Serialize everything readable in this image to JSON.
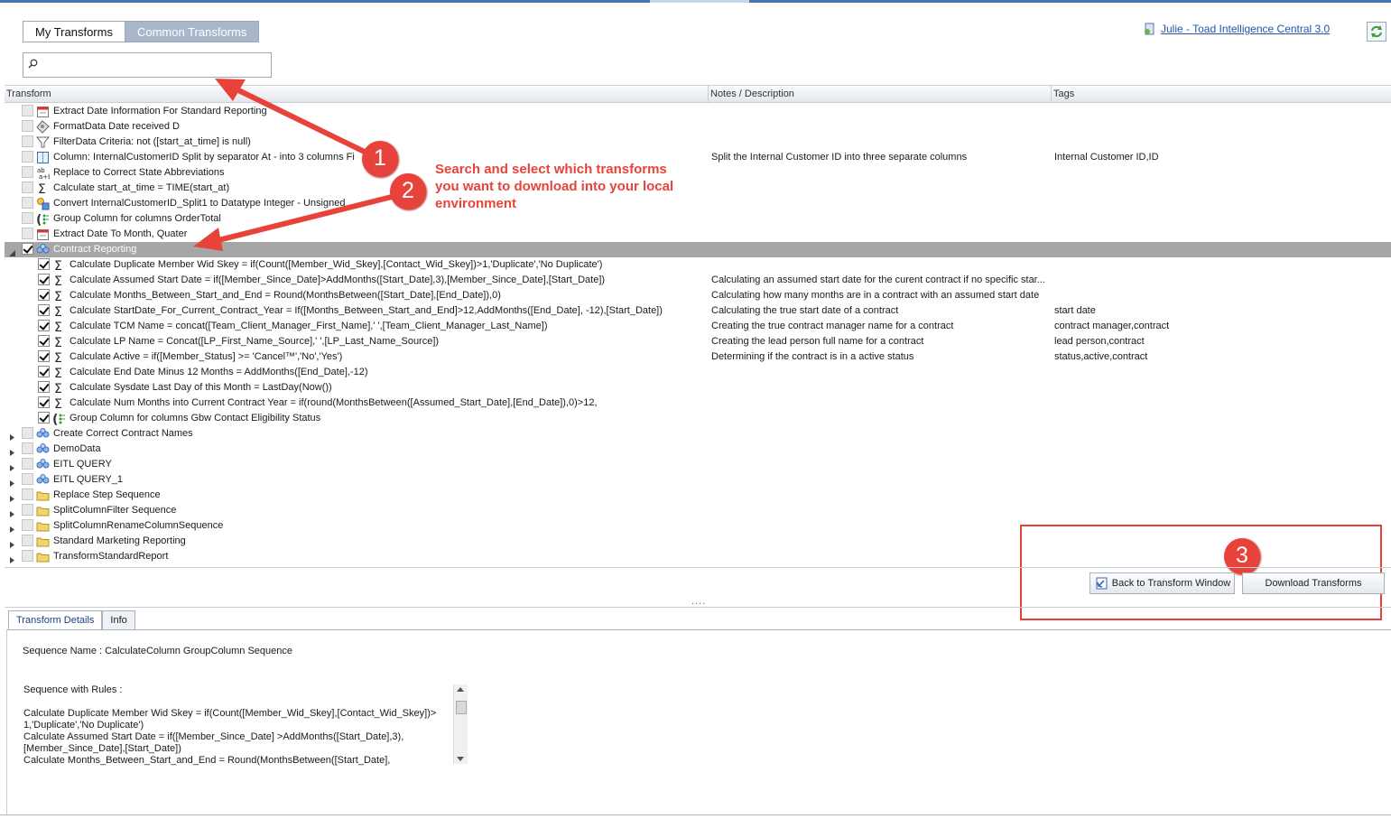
{
  "tabs": [
    {
      "label": "My Transforms",
      "active": true
    },
    {
      "label": "Common Transforms",
      "active": false
    }
  ],
  "search": {
    "value": ""
  },
  "account": {
    "link": "Julie - Toad Intelligence Central 3.0"
  },
  "columns": {
    "transform": "Transform",
    "notes": "Notes / Description",
    "tags": "Tags"
  },
  "rows": [
    {
      "type": "item",
      "level": 0,
      "checked": false,
      "icon": "calendar-icon",
      "label": "Extract Date Information For Standard Reporting",
      "desc": "",
      "tags": ""
    },
    {
      "type": "item",
      "level": 0,
      "checked": false,
      "icon": "format-icon",
      "label": "FormatData Date received D",
      "desc": "",
      "tags": ""
    },
    {
      "type": "item",
      "level": 0,
      "checked": false,
      "icon": "filter-icon",
      "label": "FilterData Criteria: not ([start_at_time] is null)",
      "desc": "",
      "tags": ""
    },
    {
      "type": "item",
      "level": 0,
      "checked": false,
      "icon": "split-column-icon",
      "label": "Column: InternalCustomerID Split by separator At - into 3 columns Fi",
      "desc": "Split the Internal Customer ID into three separate columns",
      "tags": "Internal Customer ID,ID"
    },
    {
      "type": "item",
      "level": 0,
      "checked": false,
      "icon": "replace-icon",
      "label": "Replace to Correct State Abbreviations",
      "desc": "",
      "tags": ""
    },
    {
      "type": "item",
      "level": 0,
      "checked": false,
      "icon": "sigma-icon",
      "label": "Calculate start_at_time = TIME(start_at)",
      "desc": "",
      "tags": ""
    },
    {
      "type": "item",
      "level": 0,
      "checked": false,
      "icon": "convert-icon",
      "label": "Convert InternalCustomerID_Split1 to Datatype Integer - Unsigned",
      "desc": "",
      "tags": ""
    },
    {
      "type": "item",
      "level": 0,
      "checked": false,
      "icon": "group-icon",
      "label": "Group Column for columns OrderTotal",
      "desc": "",
      "tags": ""
    },
    {
      "type": "item",
      "level": 0,
      "checked": false,
      "icon": "calendar-icon",
      "label": "Extract Date To Month, Quater",
      "desc": "",
      "tags": ""
    },
    {
      "type": "group",
      "level": 0,
      "checked": true,
      "expanded": true,
      "selected": true,
      "icon": "sequence-icon",
      "label": "Contract Reporting",
      "desc": "",
      "tags": ""
    },
    {
      "type": "item",
      "level": 1,
      "checked": true,
      "icon": "sigma-icon",
      "label": "Calculate Duplicate Member Wid Skey = if(Count([Member_Wid_Skey],[Contact_Wid_Skey])>1,'Duplicate','No Duplicate')",
      "desc": "",
      "tags": ""
    },
    {
      "type": "item",
      "level": 1,
      "checked": true,
      "icon": "sigma-icon",
      "label": "Calculate Assumed Start Date = if([Member_Since_Date]>AddMonths([Start_Date],3),[Member_Since_Date],[Start_Date])",
      "desc": "Calculating an assumed start date for the curent contract if no specific star...",
      "tags": ""
    },
    {
      "type": "item",
      "level": 1,
      "checked": true,
      "icon": "sigma-icon",
      "label": "Calculate Months_Between_Start_and_End = Round(MonthsBetween([Start_Date],[End_Date]),0)",
      "desc": "Calculating how many months are in a contract with an assumed start date",
      "tags": ""
    },
    {
      "type": "item",
      "level": 1,
      "checked": true,
      "icon": "sigma-icon",
      "label": "Calculate StartDate_For_Current_Contract_Year = If([Months_Between_Start_and_End]>12,AddMonths([End_Date], -12),[Start_Date])",
      "desc": "Calculating the true start date of a contract",
      "tags": "start date"
    },
    {
      "type": "item",
      "level": 1,
      "checked": true,
      "icon": "sigma-icon",
      "label": "Calculate TCM Name = concat([Team_Client_Manager_First_Name],' ',[Team_Client_Manager_Last_Name])",
      "desc": "Creating the true contract manager name for a contract",
      "tags": "contract manager,contract"
    },
    {
      "type": "item",
      "level": 1,
      "checked": true,
      "icon": "sigma-icon",
      "label": "Calculate LP Name = Concat([LP_First_Name_Source],' ',[LP_Last_Name_Source])",
      "desc": "Creating the lead person full name for a contract",
      "tags": "lead person,contract"
    },
    {
      "type": "item",
      "level": 1,
      "checked": true,
      "icon": "sigma-icon",
      "label": "Calculate Active = if([Member_Status]  >=  'Cancel™','No','Yes')",
      "desc": "Determining if the contract is in a active status",
      "tags": "status,active,contract"
    },
    {
      "type": "item",
      "level": 1,
      "checked": true,
      "icon": "sigma-icon",
      "label": "Calculate End Date Minus 12 Months = AddMonths([End_Date],-12)",
      "desc": "",
      "tags": ""
    },
    {
      "type": "item",
      "level": 1,
      "checked": true,
      "icon": "sigma-icon",
      "label": "Calculate Sysdate Last Day of this Month = LastDay(Now())",
      "desc": "",
      "tags": ""
    },
    {
      "type": "item",
      "level": 1,
      "checked": true,
      "icon": "sigma-icon",
      "label": "Calculate Num Months into Current Contract Year = if(round(MonthsBetween([Assumed_Start_Date],[End_Date]),0)>12,",
      "desc": "",
      "tags": ""
    },
    {
      "type": "item",
      "level": 1,
      "checked": true,
      "icon": "group-icon",
      "label": "Group Column for columns Gbw Contact Eligibility Status",
      "desc": "",
      "tags": ""
    },
    {
      "type": "group",
      "level": 0,
      "checked": false,
      "expanded": false,
      "icon": "sequence-icon",
      "label": "Create Correct Contract Names",
      "desc": "",
      "tags": ""
    },
    {
      "type": "group",
      "level": 0,
      "checked": false,
      "expanded": false,
      "icon": "sequence-icon",
      "label": "DemoData",
      "desc": "",
      "tags": ""
    },
    {
      "type": "group",
      "level": 0,
      "checked": false,
      "expanded": false,
      "icon": "sequence-icon",
      "label": "EITL QUERY",
      "desc": "",
      "tags": ""
    },
    {
      "type": "group",
      "level": 0,
      "checked": false,
      "expanded": false,
      "icon": "sequence-icon",
      "label": "EITL QUERY_1",
      "desc": "",
      "tags": ""
    },
    {
      "type": "group",
      "level": 0,
      "checked": false,
      "expanded": false,
      "icon": "folder-icon",
      "label": "Replace Step Sequence",
      "desc": "",
      "tags": ""
    },
    {
      "type": "group",
      "level": 0,
      "checked": false,
      "expanded": false,
      "icon": "folder-icon",
      "label": "SplitColumnFilter Sequence",
      "desc": "",
      "tags": ""
    },
    {
      "type": "group",
      "level": 0,
      "checked": false,
      "expanded": false,
      "icon": "folder-icon",
      "label": "SplitColumnRenameColumnSequence",
      "desc": "",
      "tags": ""
    },
    {
      "type": "group",
      "level": 0,
      "checked": false,
      "expanded": false,
      "icon": "folder-icon",
      "label": "Standard Marketing Reporting",
      "desc": "",
      "tags": ""
    },
    {
      "type": "group",
      "level": 0,
      "checked": false,
      "expanded": false,
      "icon": "folder-icon",
      "label": "TransformStandardReport",
      "desc": "",
      "tags": ""
    }
  ],
  "annotation": {
    "text": "Search and select which transforms you want to download into your local environment",
    "badges": [
      "1",
      "2",
      "3"
    ],
    "color": "#e8433a"
  },
  "buttons": {
    "back": "Back to Transform Window",
    "download": "Download Transforms"
  },
  "splitter": "....",
  "detail_tabs": [
    {
      "label": "Transform Details",
      "active": true
    },
    {
      "label": "Info",
      "active": false
    }
  ],
  "details": {
    "sequence_name": "Sequence Name :   CalculateColumn GroupColumn Sequence",
    "rules_label": "Sequence with Rules :",
    "rules": [
      "Calculate Duplicate Member Wid Skey = if(Count([Member_Wid_Skey],[Contact_Wid_Skey])>",
      "1,'Duplicate','No Duplicate')",
      "Calculate Assumed Start Date = if([Member_Since_Date] >AddMonths([Start_Date],3),",
      "[Member_Since_Date],[Start_Date])",
      "Calculate Months_Between_Start_and_End = Round(MonthsBetween([Start_Date],"
    ]
  },
  "colors": {
    "selected_row": "#a6a6a6",
    "tab_inactive": "#a9b7cc",
    "link": "#2455a8"
  }
}
